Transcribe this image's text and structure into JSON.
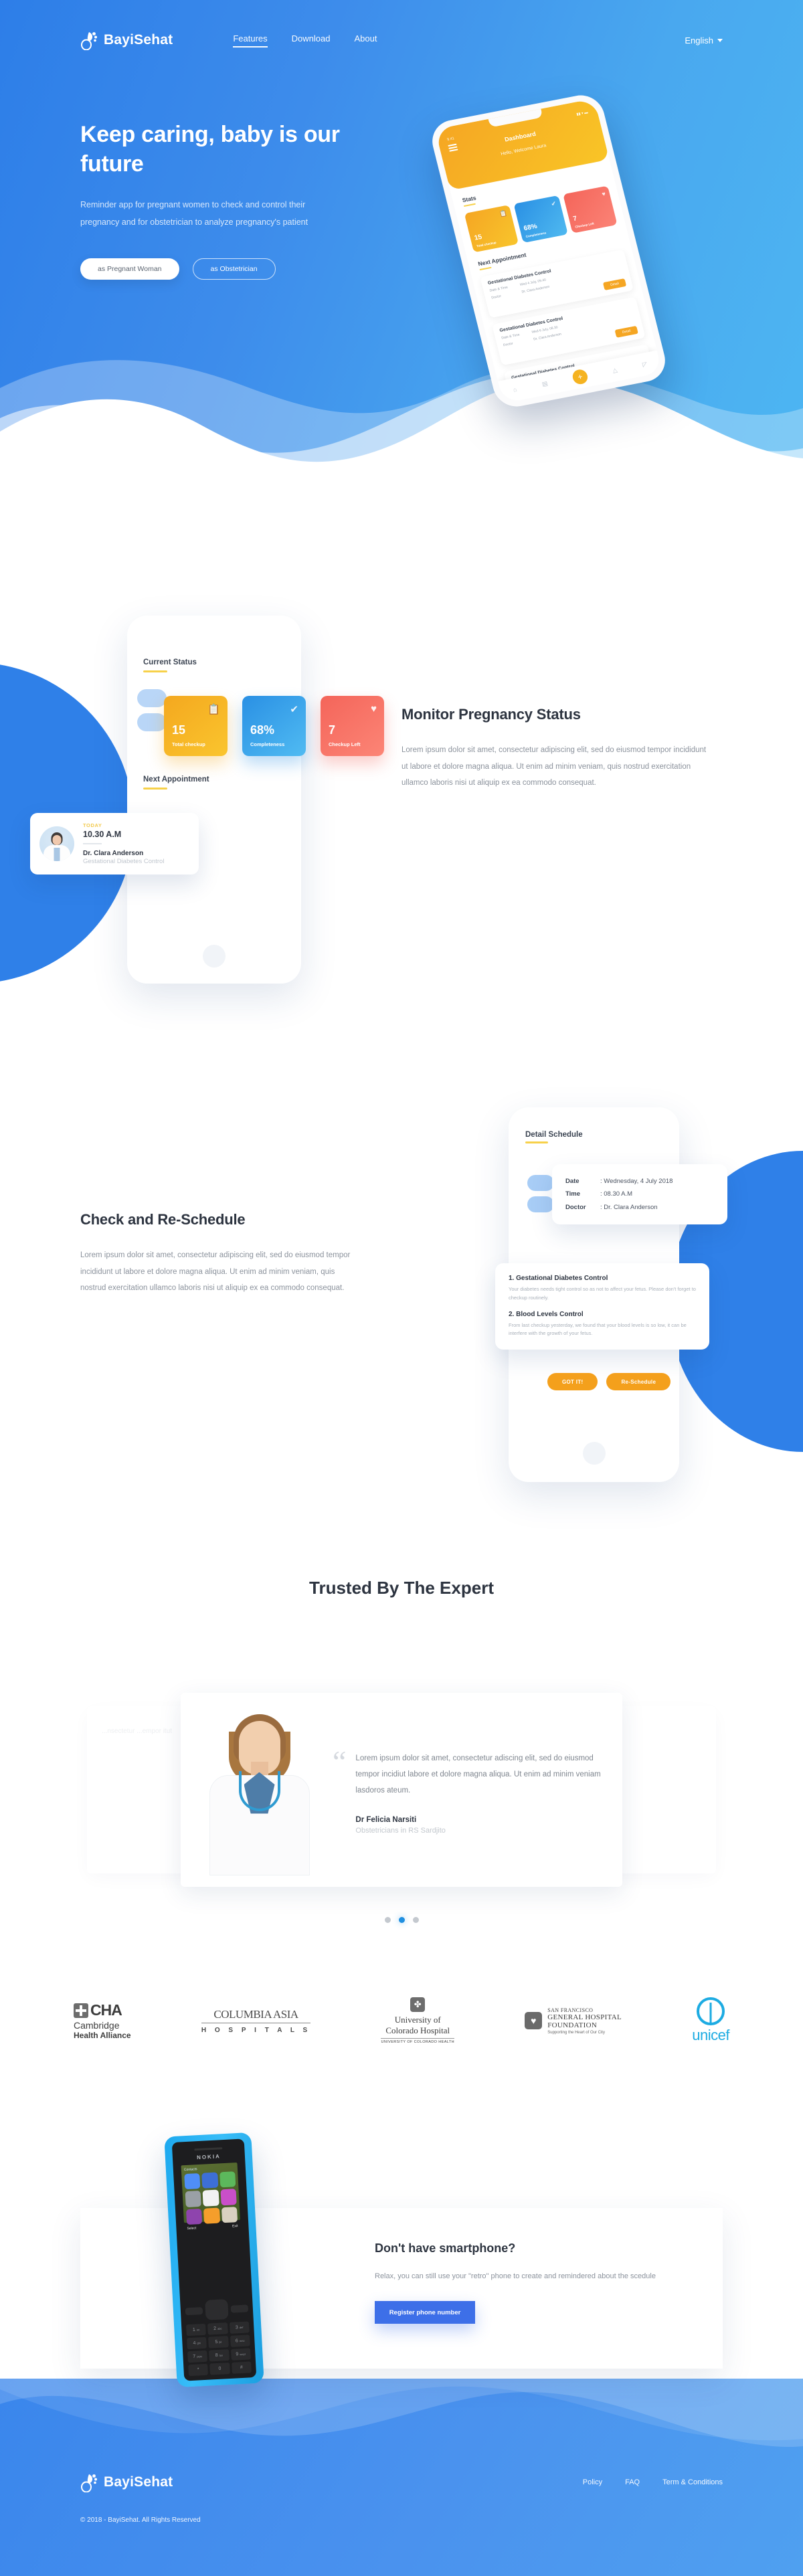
{
  "brand": {
    "name": "BayiSehat",
    "logo_icon": "baby-footprint-icon"
  },
  "nav": {
    "links": [
      {
        "label": "Features",
        "active": true
      },
      {
        "label": "Download",
        "active": false
      },
      {
        "label": "About",
        "active": false
      }
    ],
    "language": {
      "label": "English",
      "icon": "chevron-down-icon"
    }
  },
  "hero": {
    "title": "Keep caring, baby is our future",
    "subtitle": "Reminder app for pregnant women to check and control their pregnancy and for obstetrician to analyze pregnancy's patient",
    "primary_button": "as Pregnant Woman",
    "secondary_button": "as Obstetrician",
    "phone": {
      "status_time": "9.41",
      "status_icons": "signal-wifi-battery-icon",
      "menu_icon": "hamburger-menu-icon",
      "title": "Dashboard",
      "greeting": "Hello, Welcome Laura",
      "stats_heading": "Stats",
      "stats": [
        {
          "value": "15",
          "label": "Total checkup",
          "icon": "clipboard-icon",
          "color": "#f5a623"
        },
        {
          "value": "68%",
          "label": "Completeness",
          "icon": "check-circle-icon",
          "color": "#2a90e4"
        },
        {
          "value": "7",
          "label": "Checkup Left",
          "icon": "heart-pulse-icon",
          "color": "#f4655a"
        }
      ],
      "appointments_heading": "Next Appointment",
      "appointments": [
        {
          "title": "Gestational Diabetes Control",
          "date_label": "Date & Time",
          "date_value": "Wed 4 July, 09.40",
          "doctor_label": "Doctor",
          "doctor_value": "Dr. Clara Anderson",
          "button": "Detail"
        },
        {
          "title": "Gestational Diabetes Control",
          "date_label": "Date & Time",
          "date_value": "Wed 6 July, 08.30",
          "doctor_label": "Doctor",
          "doctor_value": "Dr. Clara Anderson",
          "button": "Detail"
        }
      ],
      "partial_appointment": "Gestational Diabetes Control",
      "tabbar": [
        "home-icon",
        "document-icon",
        "plus-fab-icon",
        "bell-icon",
        "chart-icon"
      ]
    }
  },
  "monitor": {
    "heading": "Monitor Pregnancy Status",
    "paragraph": "Lorem ipsum dolor sit amet, consectetur adipiscing elit, sed do eiusmod tempor incididunt ut labore et dolore magna aliqua. Ut enim ad minim veniam, quis nostrud exercitation ullamco laboris nisi ut aliquip ex ea commodo consequat.",
    "phone": {
      "current_status_label": "Current Status",
      "next_appointment_label": "Next Appointment",
      "stats": [
        {
          "value": "15",
          "label": "Total checkup",
          "icon": "clipboard-icon",
          "color": "#f4a81f"
        },
        {
          "value": "68%",
          "label": "Completeness",
          "icon": "check-circle-icon",
          "color": "#2a90e4"
        },
        {
          "value": "7",
          "label": "Checkup Left",
          "icon": "heart-pulse-icon",
          "color": "#f4655a"
        }
      ],
      "appointment": {
        "today_label": "TODAY",
        "time": "10.30 A.M",
        "doctor": "Dr. Clara Anderson",
        "subject": "Gestational Diabetes Control",
        "avatar": "doctor-avatar"
      }
    }
  },
  "schedule": {
    "heading": "Check and Re-Schedule",
    "paragraph": "Lorem ipsum dolor sit amet, consectetur adipiscing elit, sed do eiusmod tempor incididunt ut labore et dolore magna aliqua. Ut enim ad minim veniam, quis nostrud exercitation ullamco laboris nisi ut aliquip ex ea commodo consequat.",
    "phone": {
      "title": "Detail Schedule",
      "details": [
        {
          "key": "Date",
          "value": ": Wednesday, 4 July 2018"
        },
        {
          "key": "Time",
          "value": ": 08.30 A.M"
        },
        {
          "key": "Doctor",
          "value": ": Dr. Clara Anderson"
        }
      ],
      "notes": [
        {
          "heading": "1. Gestational Diabetes Control",
          "text": "Your diabetes needs tight control so as not to affect your fetus. Please don't forget to checkup routinely."
        },
        {
          "heading": "2. Blood Levels Control",
          "text": "From last checkup yesterday, we found that your blood levels is so low, it can be interfere with the growth of your fetus."
        }
      ],
      "buttons": [
        {
          "label": "GOT IT!",
          "name": "got-it-button"
        },
        {
          "label": "Re-Schedule",
          "name": "reschedule-button"
        }
      ]
    }
  },
  "testimonials": {
    "heading": "Trusted By The Expert",
    "quote_icon": "quote-mark-icon",
    "active": {
      "quote": "Lorem ipsum dolor sit amet, consectetur adiscing elit, sed do eiusmod tempor incidiut labore et dolore magna aliqua. Ut enim ad minim veniam lasdoros ateum.",
      "name": "Dr Felicia Narsiti",
      "role": "Obstetricians in RS Sardjito",
      "photo": "doctor-portrait"
    },
    "side_left_text": "...nsectetur ...empor itut",
    "side_right_text": "",
    "dots": [
      {
        "active": false
      },
      {
        "active": true
      },
      {
        "active": false
      }
    ]
  },
  "partners": [
    {
      "name": "Cambridge Health Alliance",
      "abbr": "CHA",
      "line2": "Cambridge",
      "line3": "Health Alliance",
      "icon": "cha-cross-icon"
    },
    {
      "name": "Columbia Asia Hospitals",
      "line1": "COLUMBIA ASIA",
      "line2": "H O S P I T A L S"
    },
    {
      "name": "University of Colorado Hospital",
      "line1": "University of",
      "line2": "Colorado Hospital",
      "line3": "UNIVERSITY OF COLORADO HEALTH",
      "icon": "pinwheel-icon"
    },
    {
      "name": "San Francisco General Hospital Foundation",
      "line1": "SAN FRANCISCO",
      "line2": "GENERAL HOSPITAL",
      "line3": "FOUNDATION",
      "line4": "Supporting the Heart of Our City",
      "icon": "heart-person-icon"
    },
    {
      "name": "unicef",
      "wordmark": "unicef",
      "icon": "unicef-globe-icon",
      "color": "#1cabe2"
    }
  ],
  "cta": {
    "heading": "Don't have smartphone?",
    "paragraph": "Relax, you can still use your \"retro\" phone to create and remindered about the scedule",
    "button": "Register phone number",
    "retro_phone": {
      "brand": "NOKIA",
      "screen_title": "Contacts",
      "soft_left": "Select",
      "soft_right": "Exit",
      "keys": [
        {
          "num": "1",
          "sub": "oo"
        },
        {
          "num": "2",
          "sub": "abc"
        },
        {
          "num": "3",
          "sub": "def"
        },
        {
          "num": "4",
          "sub": "ghi"
        },
        {
          "num": "5",
          "sub": "jkl"
        },
        {
          "num": "6",
          "sub": "mno"
        },
        {
          "num": "7",
          "sub": "pqrs"
        },
        {
          "num": "8",
          "sub": "tuv"
        },
        {
          "num": "9",
          "sub": "wxyz"
        },
        {
          "num": "*",
          "sub": ""
        },
        {
          "num": "0",
          "sub": ""
        },
        {
          "num": "#",
          "sub": ""
        }
      ]
    }
  },
  "footer": {
    "brand": "BayiSehat",
    "links": [
      "Policy",
      "FAQ",
      "Term & Conditions"
    ],
    "copyright": "© 2018 - BayiSehat. All Rights Reserved"
  },
  "colors": {
    "brand_blue": "#3d8ceb",
    "accent_orange": "#f4a01c",
    "accent_yellow": "#f7d14a",
    "accent_red": "#f4655a",
    "cta_blue": "#3d6fe8",
    "unicef_blue": "#1cabe2"
  }
}
